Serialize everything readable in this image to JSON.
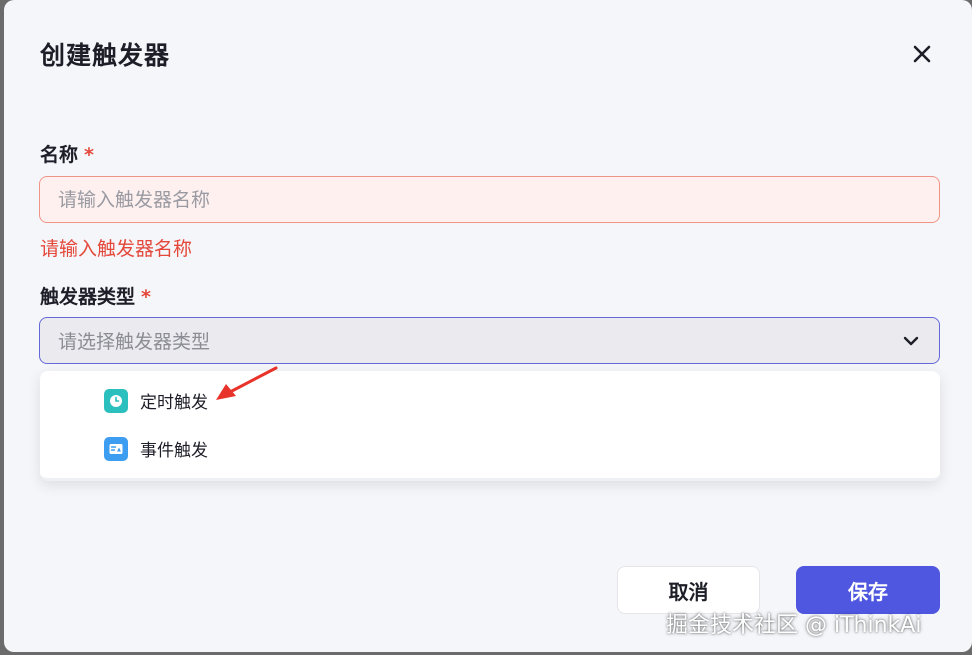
{
  "dialog": {
    "title": "创建触发器",
    "close_icon": "close-icon"
  },
  "name_field": {
    "label": "名称",
    "required_mark": "*",
    "placeholder": "请输入触发器名称",
    "value": "",
    "error": "请输入触发器名称"
  },
  "type_field": {
    "label": "触发器类型",
    "required_mark": "*",
    "placeholder": "请选择触发器类型",
    "chevron_icon": "chevron-down-icon",
    "options": [
      {
        "label": "定时触发",
        "icon": "clock-icon",
        "color": "#2bbfbd"
      },
      {
        "label": "事件触发",
        "icon": "event-icon",
        "color": "#3d9df0"
      }
    ]
  },
  "annotation": {
    "icon": "red-arrow",
    "color": "#e8332a"
  },
  "buttons": {
    "cancel": "取消",
    "save": "保存",
    "save_color": "#4f56e0"
  },
  "watermark": "掘金技术社区 @ iThinkAi"
}
